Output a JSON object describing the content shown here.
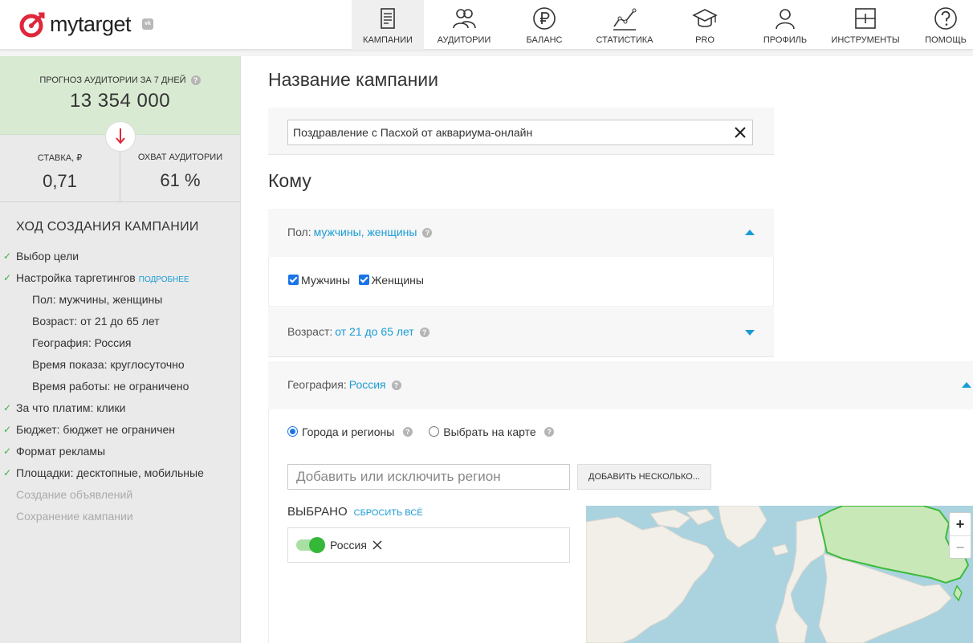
{
  "brand": {
    "logo_text": "mytarget",
    "vk_badge": "vk"
  },
  "nav": [
    {
      "label": "КАМПАНИИ",
      "icon": "campaigns-icon",
      "active": true
    },
    {
      "label": "АУДИТОРИИ",
      "icon": "audiences-icon"
    },
    {
      "label": "БАЛАНС",
      "icon": "ruble-icon"
    },
    {
      "label": "СТАТИСТИКА",
      "icon": "statistics-icon"
    },
    {
      "label": "PRO",
      "icon": "graduation-cap-icon"
    },
    {
      "label": "ПРОФИЛЬ",
      "icon": "profile-icon"
    },
    {
      "label": "ИНСТРУМЕНТЫ",
      "icon": "tools-icon"
    },
    {
      "label": "ПОМОЩЬ",
      "icon": "help-icon"
    }
  ],
  "sidebar": {
    "forecast_title": "ПРОГНОЗ АУДИТОРИИ ЗА 7 ДНЕЙ",
    "forecast_value": "13 354 000",
    "rate_label": "СТАВКА, ₽",
    "rate_value": "0,71",
    "reach_label": "ОХВАТ АУДИТОРИИ",
    "reach_value": "61 %",
    "progress_title": "ХОД СОЗДАНИЯ КАМПАНИИ",
    "steps": [
      {
        "text": "Выбор цели"
      },
      {
        "text": "Настройка таргетингов",
        "link": "ПОДРОБНЕЕ"
      },
      {
        "text": "Пол: мужчины, женщины"
      },
      {
        "text": "Возраст: от 21 до 65 лет"
      },
      {
        "text": "География: Россия"
      },
      {
        "text": "Время показа: круглосуточно"
      },
      {
        "text": "Время работы: не ограничено"
      },
      {
        "text": "За что платим: клики"
      },
      {
        "text": "Бюджет: бюджет не ограничен"
      },
      {
        "text": "Формат рекламы"
      },
      {
        "text": "Площадки: десктопные, мобильные"
      },
      {
        "text": "Создание объявлений"
      },
      {
        "text": "Сохранение кампании"
      }
    ]
  },
  "main": {
    "campaign_name_title": "Название кампании",
    "campaign_name_value": "Поздравление с Пасхой от аквариума-онлайн",
    "audience_title": "Кому",
    "gender_label": "Пол:",
    "gender_value": "мужчины, женщины",
    "gender_options": [
      "Мужчины",
      "Женщины"
    ],
    "age_label": "Возраст:",
    "age_value": "от 21 до 65 лет",
    "geo_label": "География:",
    "geo_value": "Россия",
    "geo_mode_options": [
      "Города и регионы",
      "Выбрать на карте"
    ],
    "region_placeholder": "Добавить или исключить регион",
    "add_many_label": "ДОБАВИТЬ НЕСКОЛЬКО...",
    "selected_title": "ВЫБРАНО",
    "reset_label": "СБРОСИТЬ ВСЁ",
    "selected_region": "Россия",
    "zoom_in": "+",
    "zoom_out": "−"
  },
  "colors": {
    "accent": "#1a9cd5",
    "forecast_bg": "#d9ead3",
    "check_green": "#3fae49",
    "toggle_green": "#35b83a",
    "logo_red": "#e0263b"
  }
}
